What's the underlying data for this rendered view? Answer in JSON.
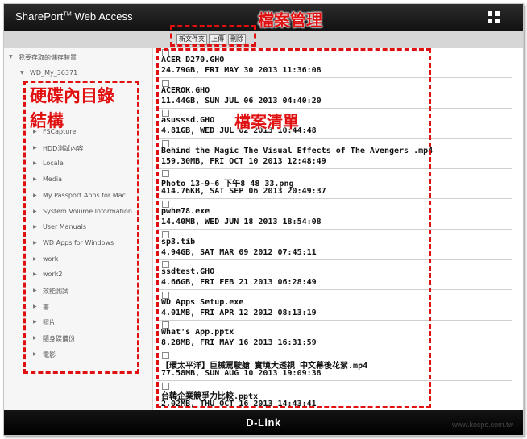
{
  "header": {
    "app_title": "SharePort",
    "tm": "TM",
    "app_subtitle": "Web Access"
  },
  "toolbar": {
    "new_folder": "新文件夾",
    "upload": "上傳",
    "delete": "刪除"
  },
  "sidebar": {
    "root": "我要存取的儲存裝置",
    "drive": "WD_My_36371",
    "items": [
      "FSCapture",
      "HDD測試內容",
      "Locale",
      "Media",
      "My Passport Apps for Mac",
      "System Volume Information",
      "User Manuals",
      "WD Apps for Windows",
      "work",
      "work2",
      "效能測試",
      "書",
      "照片",
      "隨身碟備份",
      "電影"
    ]
  },
  "files": [
    {
      "name": "ACER D270.GHO",
      "meta": "24.79GB, FRI MAY 30 2013 11:36:08"
    },
    {
      "name": "ACEROK.GHO",
      "meta": "11.44GB, SUN JUL 06 2013 04:40:20"
    },
    {
      "name": "asusssd.GHO",
      "meta": "4.81GB, WED JUL 02 2013 10:44:48"
    },
    {
      "name": "Behind the Magic The Visual Effects of The Avengers .mp4",
      "meta": "159.30MB, FRI OCT 10 2013 12:48:49"
    },
    {
      "name": "Photo 13-9-6 下午8 48 33.png",
      "meta": "414.76KB, SAT SEP 06 2013 20:49:37"
    },
    {
      "name": "pwhe78.exe",
      "meta": "14.40MB, WED JUN 18 2013 18:54:08"
    },
    {
      "name": "sp3.tib",
      "meta": "4.94GB, SAT MAR 09 2012 07:45:11"
    },
    {
      "name": "ssdtest.GHO",
      "meta": "4.66GB, FRI FEB 21 2013 06:28:49"
    },
    {
      "name": "WD Apps Setup.exe",
      "meta": "4.01MB, FRI APR 12 2012 08:13:19"
    },
    {
      "name": "What's App.pptx",
      "meta": "8.28MB, FRI MAY 16 2013 16:31:59"
    },
    {
      "name": "【環太平洋】巨械罵駛艙 實境大透視 中文幕後花絮.mp4",
      "meta": "77.58MB, SUN AUG 10 2013 19:09:38"
    },
    {
      "name": "台韓企業競爭力比較.pptx",
      "meta": "2.02MB, THU OCT 16 2013 14:43:41"
    }
  ],
  "footer": {
    "brand": "D-Link"
  },
  "annotations": {
    "file_management": "檔案管理",
    "directory_line1": "硬碟內目錄",
    "directory_line2": "結構",
    "file_list": "檔案清單"
  },
  "watermark": "www.kocpc.com.tw",
  "colors": {
    "annotation": "#e01010",
    "header": "#1a1a1a"
  }
}
